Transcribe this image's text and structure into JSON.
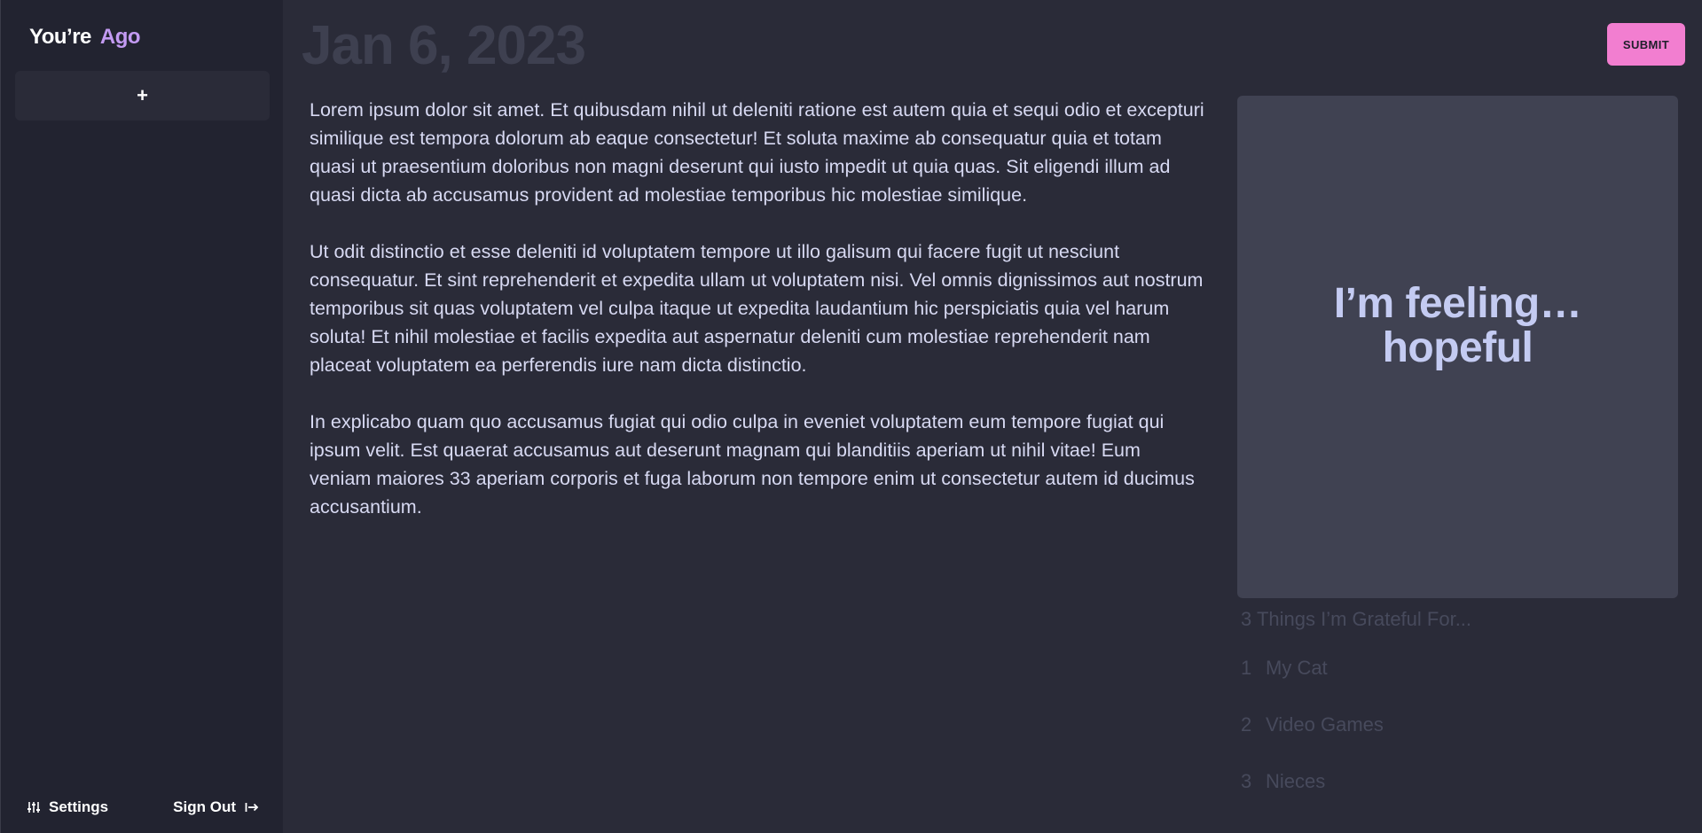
{
  "app": {
    "brand": "You’re",
    "brand_accent": "Ago",
    "accent_color": "#c39af2"
  },
  "sidebar": {
    "new_entry_label": "+",
    "settings_label": "Settings",
    "settings_icon": "sliders-icon",
    "signout_label": "Sign Out",
    "signout_icon": "sign-out-icon"
  },
  "header": {
    "date": "Jan 6, 2023",
    "submit_label": "SUBMIT",
    "submit_color": "#f27ed0"
  },
  "entry": {
    "paragraphs": [
      "Lorem ipsum dolor sit amet. Et quibusdam nihil ut deleniti ratione est autem quia et sequi odio et excepturi similique est tempora dolorum ab eaque consectetur! Et soluta maxime ab consequatur quia et totam quasi ut praesentium doloribus non magni deserunt qui iusto impedit ut quia quas. Sit eligendi illum ad quasi dicta ab accusamus provident ad molestiae temporibus hic molestiae similique.",
      "Ut odit distinctio et esse deleniti id voluptatem tempore ut illo galisum qui facere fugit ut nesciunt consequatur. Et sint reprehenderit et expedita ullam ut voluptatem nisi. Vel omnis dignissimos aut nostrum temporibus sit quas voluptatem vel culpa itaque ut expedita laudantium hic perspiciatis quia vel harum soluta! Et nihil molestiae et facilis expedita aut aspernatur deleniti cum molestiae reprehenderit nam placeat voluptatem ea perferendis iure nam dicta distinctio.",
      "In explicabo quam quo accusamus fugiat qui odio culpa in eveniet voluptatem eum tempore fugiat qui ipsum velit. Est quaerat accusamus aut deserunt magnam qui blanditiis aperiam ut nihil vitae! Eum veniam maiores 33 aperiam corporis et fuga laborum non tempore enim ut consectetur autem id ducimus accusantium."
    ]
  },
  "mood": {
    "prefix": "I’m feeling…",
    "value": "hopeful"
  },
  "grateful": {
    "title": "3 Things I’m Grateful For...",
    "items": [
      {
        "num": "1",
        "text": "My Cat"
      },
      {
        "num": "2",
        "text": "Video Games"
      },
      {
        "num": "3",
        "text": "Nieces"
      }
    ]
  }
}
